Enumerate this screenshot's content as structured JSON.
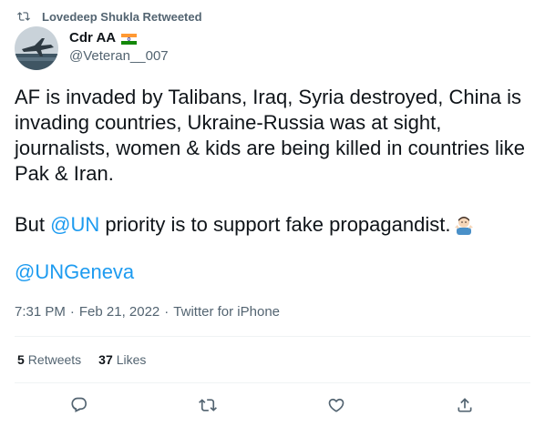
{
  "social_context": {
    "retweeted_by": "Lovedeep Shukla Retweeted",
    "icon": "retweet-icon"
  },
  "author": {
    "display_name": "Cdr AA",
    "handle": "@Veteran__007",
    "flag": "india-flag-icon",
    "avatar": "fighter-jet-avatar"
  },
  "tweet": {
    "line1": "AF is invaded by Talibans, Iraq, Syria destroyed, China is invading countries, Ukraine-Russia was at sight, journalists, women & kids are being killed in countries like Pak & Iran.",
    "line2_before": "But ",
    "line2_mention": "@UN",
    "line2_after": " priority is to support fake propagandist.",
    "line2_emoji": "person-shrugging-emoji",
    "line3_mention": "@UNGeneva"
  },
  "meta": {
    "time": "7:31 PM",
    "date": "Feb 21, 2022",
    "source": "Twitter for iPhone",
    "separator": "·"
  },
  "stats": {
    "retweets_count": "5",
    "retweets_label": "Retweets",
    "likes_count": "37",
    "likes_label": "Likes"
  },
  "actions": [
    "reply-icon",
    "retweet-icon",
    "like-icon",
    "share-icon"
  ],
  "colors": {
    "accent": "#1d9bf0",
    "text": "#0f1419",
    "secondary": "#536471",
    "divider": "#eff3f4"
  }
}
